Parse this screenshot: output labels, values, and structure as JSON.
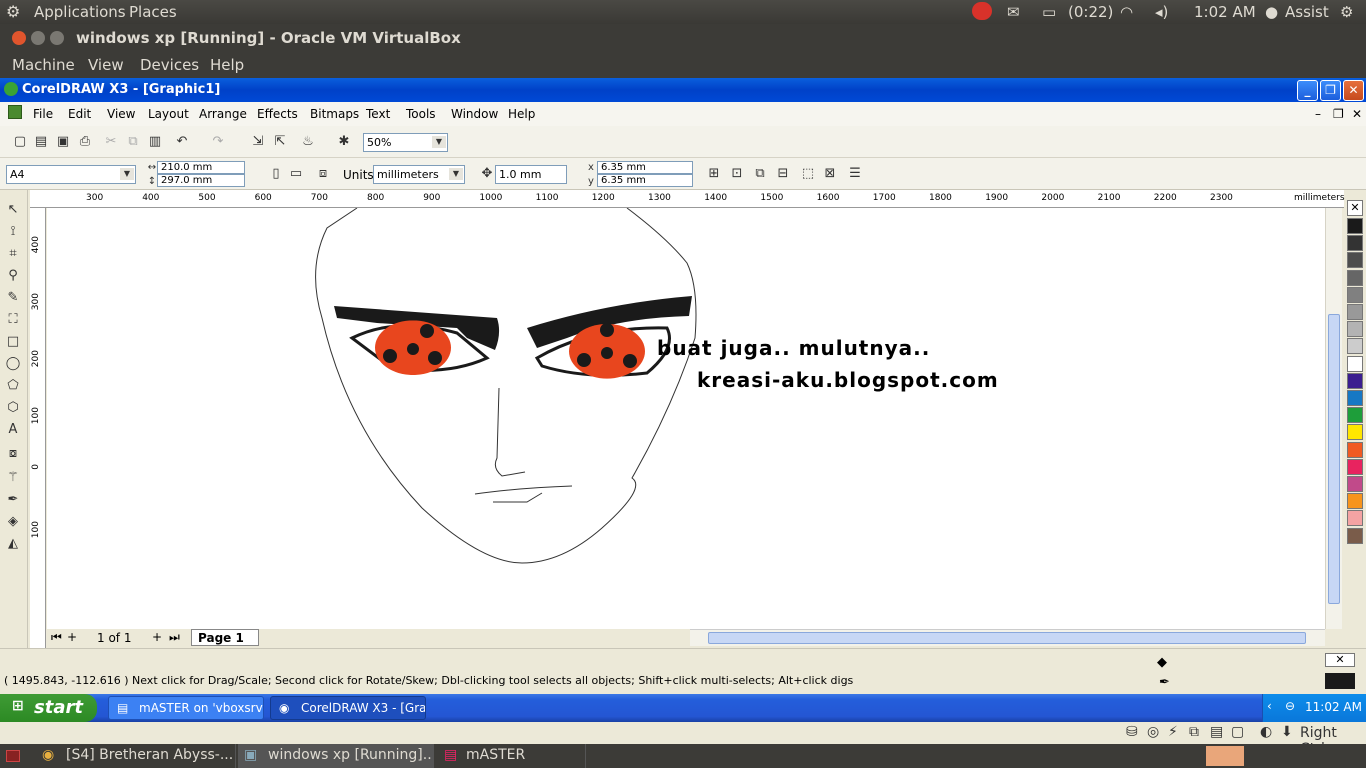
{
  "top_panel": {
    "applications": "Applications",
    "places": "Places",
    "battery": "(0:22)",
    "time": "1:02 AM",
    "user": "Assist"
  },
  "vbox": {
    "title": "windows xp [Running] - Oracle VM VirtualBox",
    "menu": [
      "Machine",
      "View",
      "Devices",
      "Help"
    ],
    "host_key": "Right Ctrl"
  },
  "corel": {
    "title": "CorelDRAW X3 - [Graphic1]",
    "menu": [
      "File",
      "Edit",
      "View",
      "Layout",
      "Arrange",
      "Effects",
      "Bitmaps",
      "Text",
      "Tools",
      "Window",
      "Help"
    ],
    "zoom": "50%",
    "paper": "A4",
    "width": "210.0 mm",
    "height": "297.0 mm",
    "units_label": "Units:",
    "units": "millimeters",
    "nudge": "1.0 mm",
    "dup_x": "6.35 mm",
    "dup_y": "6.35 mm",
    "ruler_h": [
      "300",
      "400",
      "500",
      "600",
      "700",
      "800",
      "900",
      "1000",
      "1100",
      "1200",
      "1300",
      "1400",
      "1500",
      "1600",
      "1700",
      "1800",
      "1900",
      "2000",
      "2100",
      "2200",
      "2300"
    ],
    "ruler_unit": "millimeters",
    "ruler_v": [
      "400",
      "300",
      "200",
      "100",
      "0",
      "100"
    ],
    "canvas_text1": "buat juga.. mulutnya..",
    "canvas_text2": "kreasi-aku.blogspot.com",
    "page_count": "1 of 1",
    "page_tab": "Page 1",
    "status": "( 1495.843, -112.616 )  Next click for Drag/Scale; Second click for Rotate/Skew; Dbl-clicking tool selects all objects; Shift+click multi-selects; Alt+click digs",
    "palette": [
      "#1a1a1a",
      "#333333",
      "#4d4d4d",
      "#666666",
      "#808080",
      "#999999",
      "#b3b3b3",
      "#cccccc",
      "#ffffff",
      "#3b1e8f",
      "#1778c4",
      "#1e9e3a",
      "#ffe600",
      "#f05a22",
      "#e8235f",
      "#c14a8a",
      "#f7941d",
      "#f4a3a3",
      "#7a5c4a"
    ]
  },
  "xp_taskbar": {
    "start": "start",
    "tasks": [
      "mASTER on 'vboxsrv' ...",
      "CorelDRAW X3 - [Gra..."
    ],
    "clock": "11:02 AM"
  },
  "bottom_panel": {
    "tasks": [
      "[S4] Bretheran Abyss-...",
      "windows xp [Running]...",
      "mASTER"
    ]
  }
}
